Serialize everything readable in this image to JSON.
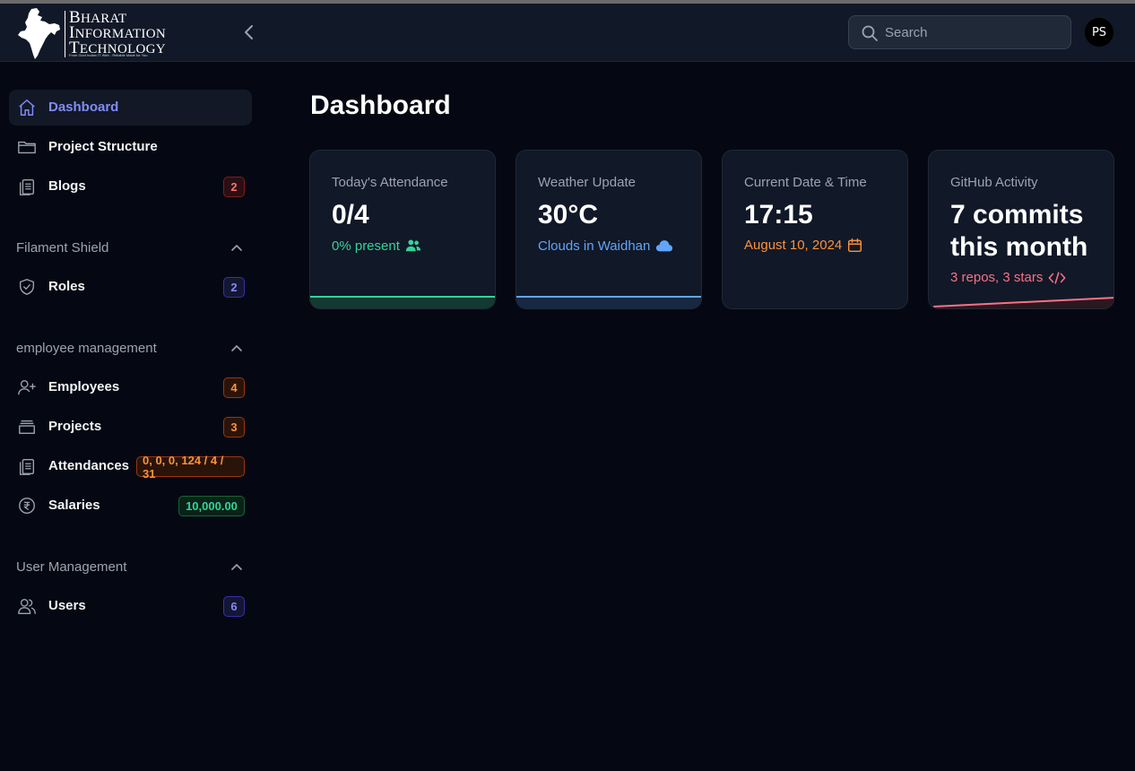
{
  "header": {
    "logo": {
      "line1_first": "B",
      "line1_rest": "HARAT",
      "line2_first": "I",
      "line2_rest": "NFORMATION",
      "line3_first": "T",
      "line3_rest": "ECHNOLOGY",
      "tagline": "From Govt Indian IT Web - Reliable Made for You"
    },
    "search_placeholder": "Search",
    "avatar_initials": "PS"
  },
  "sidebar": {
    "top_items": [
      {
        "label": "Dashboard",
        "icon": "home-icon",
        "active": true
      },
      {
        "label": "Project Structure",
        "icon": "folder-icon"
      },
      {
        "label": "Blogs",
        "icon": "clipboard-icon",
        "badge": "2"
      }
    ],
    "groups": [
      {
        "label": "Filament Shield",
        "items": [
          {
            "label": "Roles",
            "icon": "shield-check-icon",
            "badge": "2"
          }
        ]
      },
      {
        "label": "employee management",
        "items": [
          {
            "label": "Employees",
            "icon": "user-plus-icon",
            "badge": "4"
          },
          {
            "label": "Projects",
            "icon": "archive-box-icon",
            "badge": "3"
          },
          {
            "label": "Attendances",
            "icon": "clipboard-list-icon",
            "badge": "0, 0, 0, 124 / 4 / 31"
          },
          {
            "label": "Salaries",
            "icon": "rupee-circle-icon",
            "badge": "10,000.00"
          }
        ]
      },
      {
        "label": "User Management",
        "items": [
          {
            "label": "Users",
            "icon": "users-icon",
            "badge": "6"
          }
        ]
      }
    ]
  },
  "main": {
    "title": "Dashboard",
    "cards": [
      {
        "title": "Today's Attendance",
        "value": "0/4",
        "description": "0% present",
        "icon": "user-group-icon",
        "color": "#34d399"
      },
      {
        "title": "Weather Update",
        "value": "30°C",
        "description": "Clouds in Waidhan",
        "icon": "cloud-icon",
        "color": "#60a5fa"
      },
      {
        "title": "Current Date & Time",
        "value": "17:15",
        "description": "August 10, 2024",
        "icon": "calendar-icon",
        "color": "#fb923c"
      },
      {
        "title": "GitHub Activity",
        "value": "7 commits this month",
        "description": "3 repos, 3 stars",
        "icon": "code-bracket-icon",
        "color": "#fb7185"
      }
    ]
  },
  "colors": {
    "accent": "#818cf8",
    "background": "#050812",
    "card": "#111827"
  }
}
